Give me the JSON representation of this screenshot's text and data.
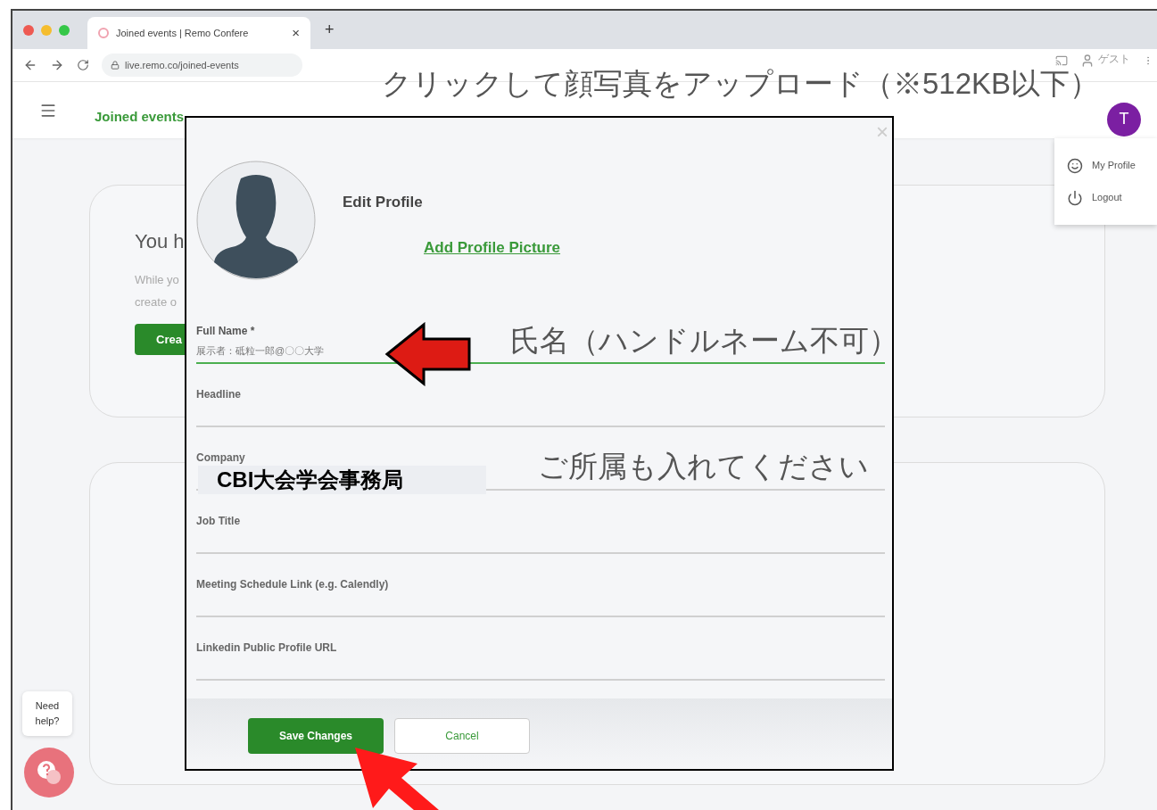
{
  "browser": {
    "tab_title": "Joined events | Remo Confere",
    "tab_close": "×",
    "new_tab": "+",
    "url": "live.remo.co/joined-events",
    "profile_label": "ゲスト"
  },
  "app_header": {
    "title": "Joined events",
    "avatar_initial": "T"
  },
  "user_menu": [
    {
      "label": "My Profile",
      "kind": "profile"
    },
    {
      "label": "Logout",
      "kind": "logout"
    }
  ],
  "background_card": {
    "title": "You h",
    "text_lines": [
      "While yo",
      "create o"
    ],
    "button": "Crea"
  },
  "modal": {
    "title": "Edit Profile",
    "close": "×",
    "add_picture_link": "Add Profile Picture",
    "fields": [
      {
        "label": "Full Name *",
        "value": "展示者：砥粒一郎@〇〇大学",
        "focused": true
      },
      {
        "label": "Headline",
        "focused": false
      },
      {
        "label": "Company",
        "focused": false
      },
      {
        "label": "Job Title",
        "focused": false
      },
      {
        "label": "Meeting Schedule Link (e.g. Calendly)",
        "focused": false
      },
      {
        "label": "Linkedin Public Profile URL",
        "focused": false
      }
    ],
    "save_button": "Save Changes",
    "cancel_button": "Cancel"
  },
  "help_widget": {
    "bubble": "Need help?"
  },
  "annotations": [
    {
      "kind": "callout",
      "text": "クリックして顔写真をアップロード（※512KB以下）"
    },
    {
      "kind": "callout",
      "text": "氏名（ハンドルネーム不可）"
    },
    {
      "kind": "pasted_value",
      "text": "CBI大会学会事務局"
    },
    {
      "kind": "callout",
      "text": "ご所属も入れてください"
    }
  ]
}
